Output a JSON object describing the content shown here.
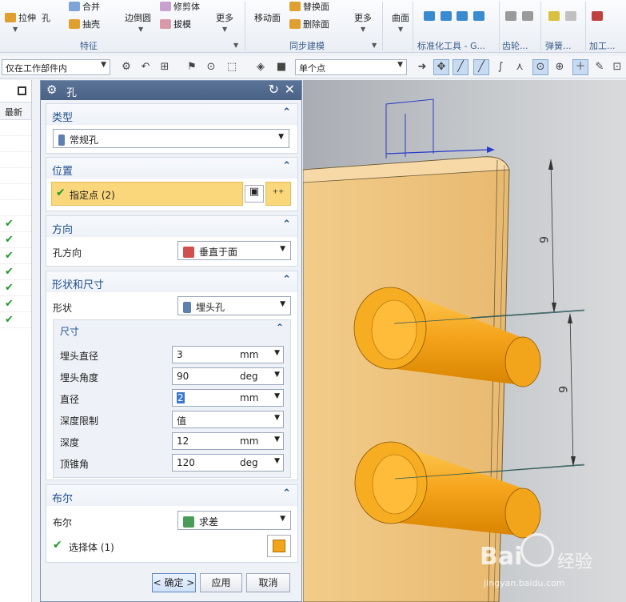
{
  "ribbon": {
    "buttons": {
      "extrude": "拉伸",
      "hole": "孔",
      "unite": "合并",
      "shell": "抽壳",
      "edge_blend": "边倒圆",
      "trim_body": "修剪体",
      "draft": "拔模",
      "more1": "更多",
      "move_face": "移动面",
      "replace_face": "替换面",
      "delete_face": "删除面",
      "more2": "更多",
      "surface": "曲面"
    },
    "groups": {
      "feature": "特征",
      "sync_modeling": "同步建模",
      "std_tools": "标准化工具 - G...",
      "gear": "齿轮...",
      "spring": "弹簧...",
      "machining": "加工..."
    }
  },
  "toolbar": {
    "filter_combo": "仅在工作部件内",
    "snap_combo": "单个点"
  },
  "left_panel": {
    "column_header": "最新",
    "check_rows": 7
  },
  "dialog": {
    "title": "孔",
    "sections": {
      "type": {
        "title": "类型",
        "value": "常规孔"
      },
      "position": {
        "title": "位置",
        "specify_point": "指定点 (2)"
      },
      "direction": {
        "title": "方向",
        "label": "孔方向",
        "value": "垂直于面"
      },
      "shape": {
        "title": "形状和尺寸",
        "shape_label": "形状",
        "shape_value": "埋头孔",
        "dims_title": "尺寸",
        "fields": [
          {
            "label": "埋头直径",
            "value": "3",
            "unit": "mm"
          },
          {
            "label": "埋头角度",
            "value": "90",
            "unit": "deg"
          },
          {
            "label": "直径",
            "value": "2",
            "unit": "mm"
          },
          {
            "label": "深度限制",
            "value": "值",
            "unit": ""
          },
          {
            "label": "深度",
            "value": "12",
            "unit": "mm"
          },
          {
            "label": "顶锥角",
            "value": "120",
            "unit": "deg"
          }
        ]
      },
      "boolean": {
        "title": "布尔",
        "label": "布尔",
        "value": "求差",
        "select_body": "选择体 (1)"
      }
    },
    "buttons": {
      "ok": "< 确定 >",
      "apply": "应用",
      "cancel": "取消"
    }
  },
  "viewport": {
    "dim_labels": [
      "6",
      "6"
    ],
    "watermark_main": "Bai",
    "watermark_cn": "经验",
    "watermark_url": "jingyan.baidu.com"
  }
}
